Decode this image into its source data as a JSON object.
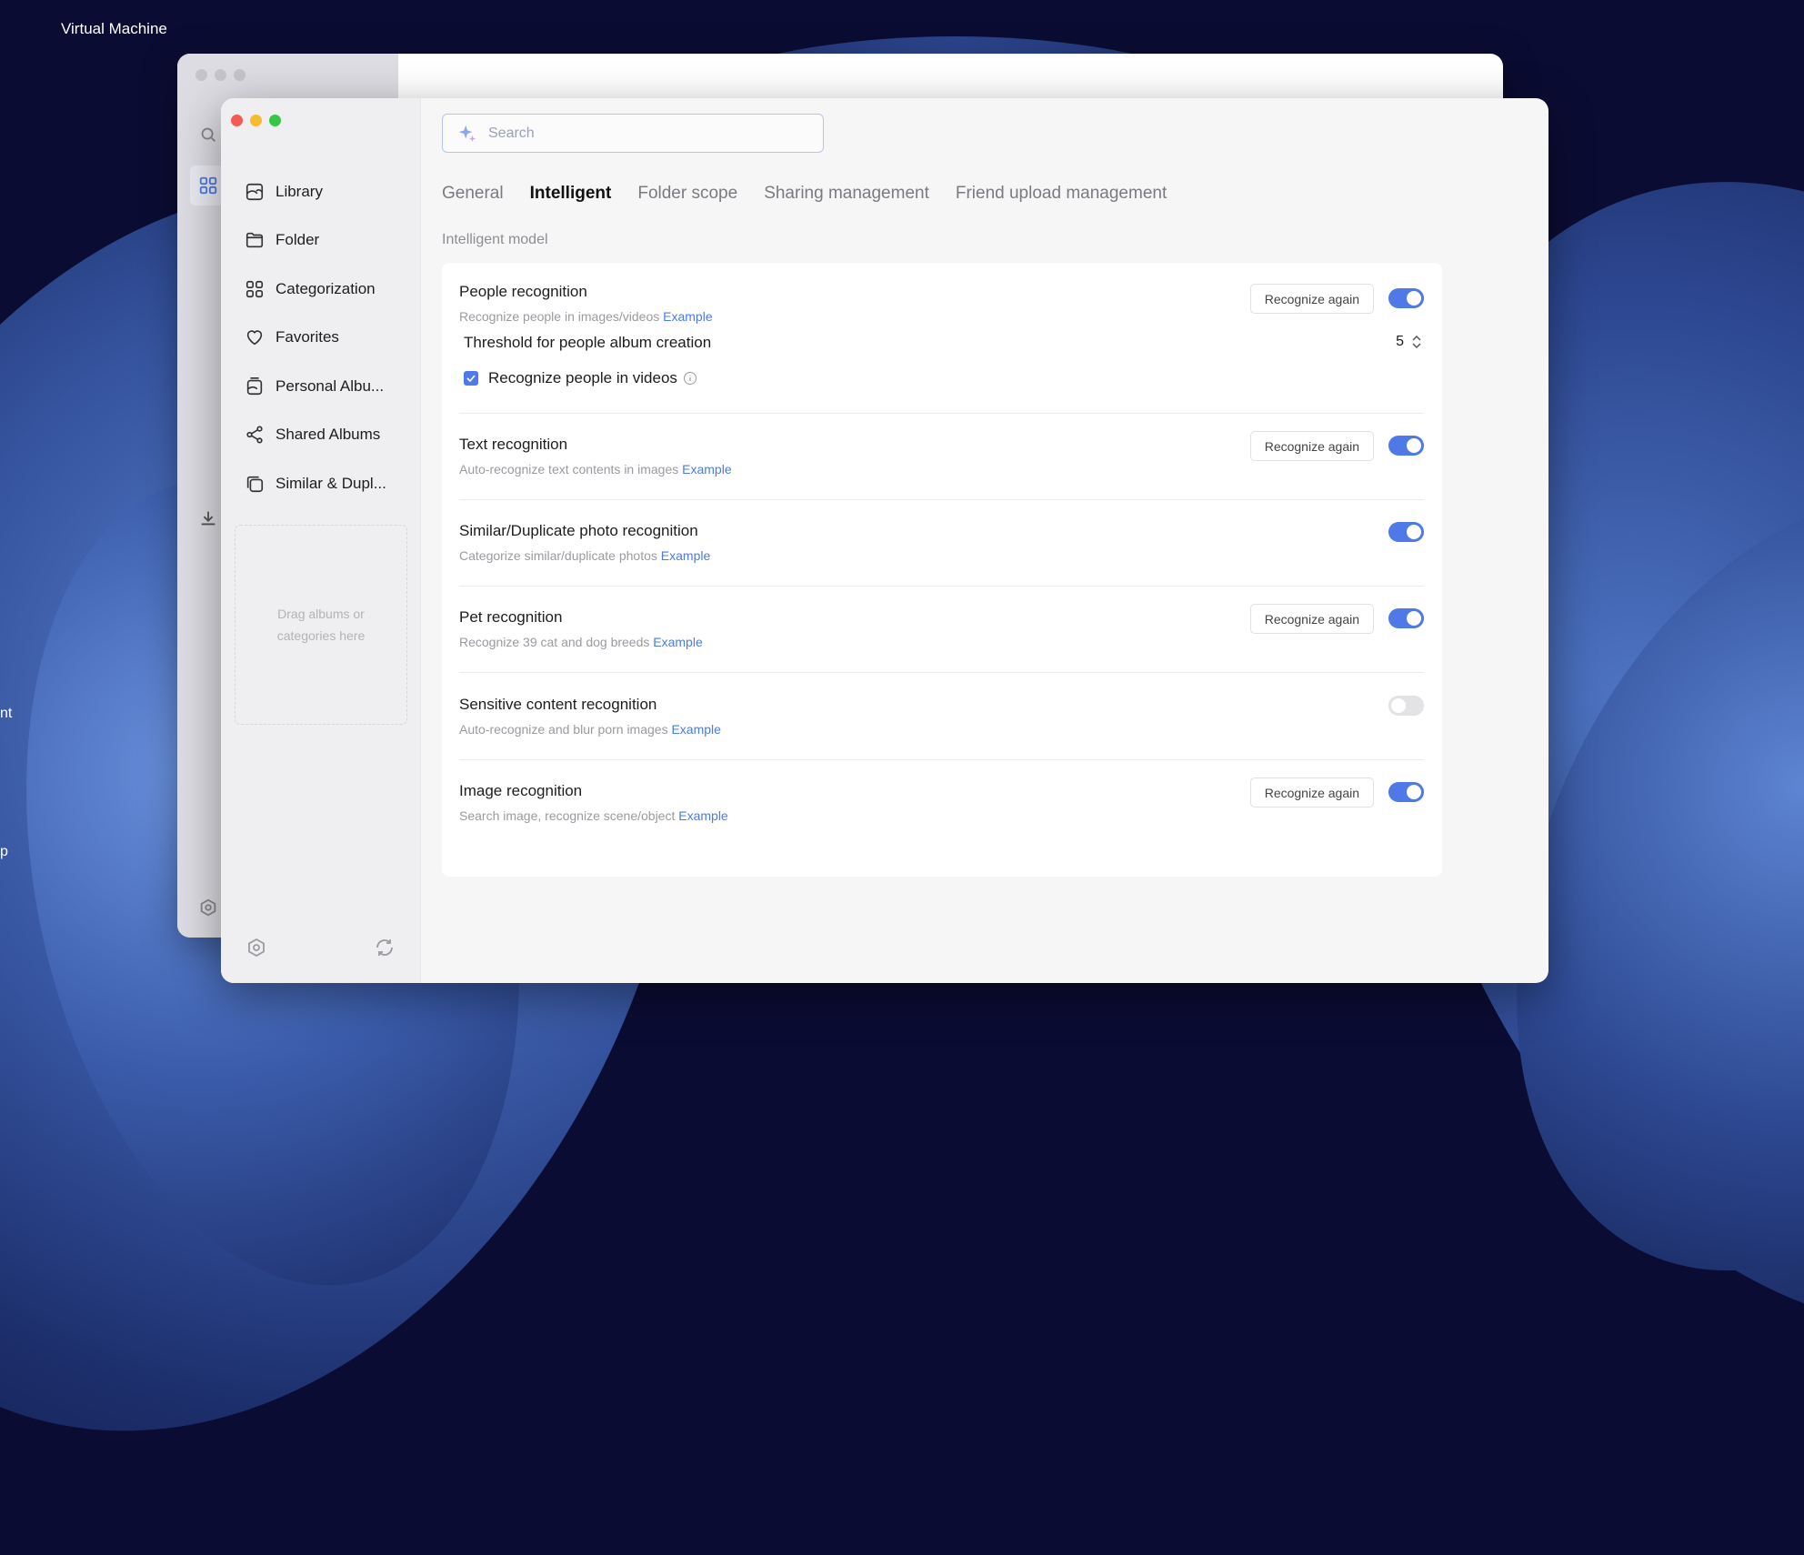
{
  "desktop": {
    "title": "Virtual Machine",
    "edge_labels": [
      "nt",
      "p"
    ]
  },
  "sidebar": {
    "items": [
      {
        "label": "Library",
        "icon": "library-icon"
      },
      {
        "label": "Folder",
        "icon": "folder-icon"
      },
      {
        "label": "Categorization",
        "icon": "grid-icon"
      },
      {
        "label": "Favorites",
        "icon": "heart-icon"
      },
      {
        "label": "Personal Albu...",
        "icon": "album-icon"
      },
      {
        "label": "Shared Albums",
        "icon": "share-icon"
      },
      {
        "label": "Similar & Dupl...",
        "icon": "duplicate-icon"
      }
    ],
    "drop_zone": "Drag albums or categories here"
  },
  "search": {
    "placeholder": "Search"
  },
  "tabs": [
    {
      "label": "General",
      "active": false
    },
    {
      "label": "Intelligent",
      "active": true
    },
    {
      "label": "Folder scope",
      "active": false
    },
    {
      "label": "Sharing management",
      "active": false
    },
    {
      "label": "Friend upload management",
      "active": false
    }
  ],
  "section_title": "Intelligent model",
  "recognize_again_label": "Recognize again",
  "example_label": "Example",
  "features": [
    {
      "title": "People recognition",
      "desc": "Recognize people in images/videos",
      "enabled": true,
      "has_button": true
    },
    {
      "title": "Text recognition",
      "desc": "Auto-recognize text contents in images",
      "enabled": true,
      "has_button": true
    },
    {
      "title": "Similar/Duplicate photo recognition",
      "desc": "Categorize similar/duplicate photos",
      "enabled": true,
      "has_button": false
    },
    {
      "title": "Pet recognition",
      "desc": "Recognize 39 cat and dog breeds",
      "enabled": true,
      "has_button": true
    },
    {
      "title": "Sensitive content recognition",
      "desc": "Auto-recognize and blur porn images",
      "enabled": false,
      "has_button": false
    },
    {
      "title": "Image recognition",
      "desc": "Search image, recognize scene/object",
      "enabled": true,
      "has_button": true
    }
  ],
  "people_options": {
    "threshold_label": "Threshold for people album creation",
    "threshold_value": "5",
    "videos_label": "Recognize people in videos",
    "videos_checked": true
  },
  "colors": {
    "accent": "#4e79e6",
    "link": "#4b7be5",
    "toggle_off": "#e3e3e6"
  }
}
